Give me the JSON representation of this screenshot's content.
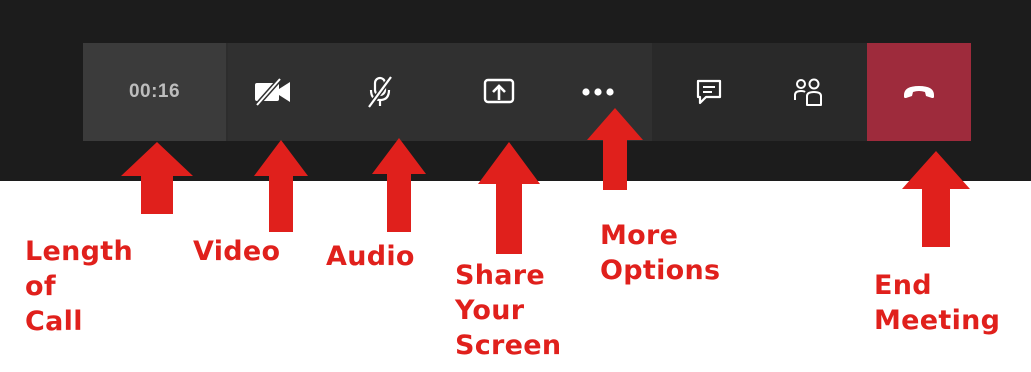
{
  "toolbar": {
    "call_duration": "00:16",
    "buttons": [
      {
        "name": "video",
        "icon": "camera-off-icon"
      },
      {
        "name": "audio",
        "icon": "microphone-off-icon"
      },
      {
        "name": "share",
        "icon": "share-screen-icon"
      },
      {
        "name": "more",
        "icon": "more-dots-icon"
      },
      {
        "name": "chat",
        "icon": "chat-icon"
      },
      {
        "name": "participants",
        "icon": "people-icon"
      },
      {
        "name": "end",
        "icon": "hang-up-icon"
      }
    ],
    "colors": {
      "bar": "#2d2d2d",
      "end_button": "#9e2b3c",
      "icon": "#ffffff"
    }
  },
  "annotations": {
    "color": "#e0201c",
    "length_of_call": [
      "Length",
      "of",
      "Call"
    ],
    "video": [
      "Video"
    ],
    "audio": [
      "Audio"
    ],
    "share_your_screen": [
      "Share",
      "Your",
      "Screen"
    ],
    "more_options": [
      "More",
      "Options"
    ],
    "end_meeting": [
      "End",
      "Meeting"
    ]
  }
}
